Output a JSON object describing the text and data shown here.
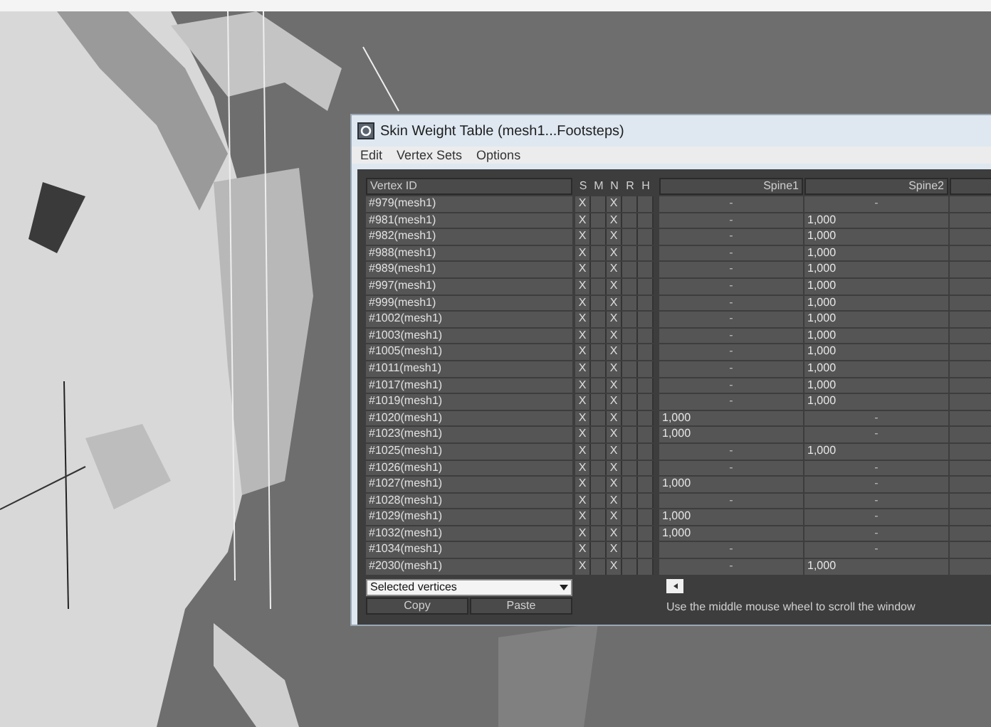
{
  "window": {
    "title": "Skin Weight Table (mesh1...Footsteps)"
  },
  "menu": [
    "Edit",
    "Vertex Sets",
    "Options"
  ],
  "columns": {
    "vertex": "Vertex ID",
    "flags": [
      "S",
      "M",
      "N",
      "R",
      "H"
    ],
    "bones": [
      "Spine1",
      "Spine2"
    ]
  },
  "rows": [
    {
      "id": "#979(mesh1)",
      "s": "X",
      "n": "X",
      "weights": [
        {
          "kind": "empty",
          "text": "-"
        },
        {
          "kind": "empty",
          "text": "-"
        }
      ]
    },
    {
      "id": "#981(mesh1)",
      "s": "X",
      "n": "X",
      "weights": [
        {
          "kind": "empty",
          "text": "-"
        },
        {
          "kind": "weight",
          "text": "1,000"
        }
      ]
    },
    {
      "id": "#982(mesh1)",
      "s": "X",
      "n": "X",
      "weights": [
        {
          "kind": "empty",
          "text": "-"
        },
        {
          "kind": "weight",
          "text": "1,000"
        }
      ]
    },
    {
      "id": "#988(mesh1)",
      "s": "X",
      "n": "X",
      "weights": [
        {
          "kind": "empty",
          "text": "-"
        },
        {
          "kind": "weight",
          "text": "1,000"
        }
      ]
    },
    {
      "id": "#989(mesh1)",
      "s": "X",
      "n": "X",
      "weights": [
        {
          "kind": "empty",
          "text": "-"
        },
        {
          "kind": "weight",
          "text": "1,000"
        }
      ]
    },
    {
      "id": "#997(mesh1)",
      "s": "X",
      "n": "X",
      "weights": [
        {
          "kind": "empty",
          "text": "-"
        },
        {
          "kind": "weight",
          "text": "1,000"
        }
      ]
    },
    {
      "id": "#999(mesh1)",
      "s": "X",
      "n": "X",
      "weights": [
        {
          "kind": "empty",
          "text": "-"
        },
        {
          "kind": "weight",
          "text": "1,000"
        }
      ]
    },
    {
      "id": "#1002(mesh1)",
      "s": "X",
      "n": "X",
      "weights": [
        {
          "kind": "empty",
          "text": "-"
        },
        {
          "kind": "weight",
          "text": "1,000"
        }
      ]
    },
    {
      "id": "#1003(mesh1)",
      "s": "X",
      "n": "X",
      "weights": [
        {
          "kind": "empty",
          "text": "-"
        },
        {
          "kind": "weight",
          "text": "1,000"
        }
      ]
    },
    {
      "id": "#1005(mesh1)",
      "s": "X",
      "n": "X",
      "weights": [
        {
          "kind": "empty",
          "text": "-"
        },
        {
          "kind": "weight",
          "text": "1,000"
        }
      ]
    },
    {
      "id": "#1011(mesh1)",
      "s": "X",
      "n": "X",
      "weights": [
        {
          "kind": "empty",
          "text": "-"
        },
        {
          "kind": "weight",
          "text": "1,000"
        }
      ]
    },
    {
      "id": "#1017(mesh1)",
      "s": "X",
      "n": "X",
      "weights": [
        {
          "kind": "empty",
          "text": "-"
        },
        {
          "kind": "weight",
          "text": "1,000"
        }
      ]
    },
    {
      "id": "#1019(mesh1)",
      "s": "X",
      "n": "X",
      "weights": [
        {
          "kind": "empty",
          "text": "-"
        },
        {
          "kind": "weight",
          "text": "1,000"
        }
      ]
    },
    {
      "id": "#1020(mesh1)",
      "s": "X",
      "n": "X",
      "weights": [
        {
          "kind": "weight",
          "text": "1,000"
        },
        {
          "kind": "empty",
          "text": "-"
        }
      ]
    },
    {
      "id": "#1023(mesh1)",
      "s": "X",
      "n": "X",
      "weights": [
        {
          "kind": "weight",
          "text": "1,000"
        },
        {
          "kind": "empty",
          "text": "-"
        }
      ]
    },
    {
      "id": "#1025(mesh1)",
      "s": "X",
      "n": "X",
      "weights": [
        {
          "kind": "empty",
          "text": "-"
        },
        {
          "kind": "weight",
          "text": "1,000"
        }
      ]
    },
    {
      "id": "#1026(mesh1)",
      "s": "X",
      "n": "X",
      "weights": [
        {
          "kind": "empty",
          "text": "-"
        },
        {
          "kind": "empty",
          "text": "-"
        }
      ]
    },
    {
      "id": "#1027(mesh1)",
      "s": "X",
      "n": "X",
      "weights": [
        {
          "kind": "weight",
          "text": "1,000"
        },
        {
          "kind": "empty",
          "text": "-"
        }
      ]
    },
    {
      "id": "#1028(mesh1)",
      "s": "X",
      "n": "X",
      "weights": [
        {
          "kind": "empty",
          "text": "-"
        },
        {
          "kind": "empty",
          "text": "-"
        }
      ]
    },
    {
      "id": "#1029(mesh1)",
      "s": "X",
      "n": "X",
      "weights": [
        {
          "kind": "weight",
          "text": "1,000"
        },
        {
          "kind": "empty",
          "text": "-"
        }
      ]
    },
    {
      "id": "#1032(mesh1)",
      "s": "X",
      "n": "X",
      "weights": [
        {
          "kind": "weight",
          "text": "1,000"
        },
        {
          "kind": "empty",
          "text": "-"
        }
      ]
    },
    {
      "id": "#1034(mesh1)",
      "s": "X",
      "n": "X",
      "weights": [
        {
          "kind": "empty",
          "text": "-"
        },
        {
          "kind": "empty",
          "text": "-"
        }
      ]
    },
    {
      "id": "#2030(mesh1)",
      "s": "X",
      "n": "X",
      "weights": [
        {
          "kind": "empty",
          "text": "-"
        },
        {
          "kind": "weight",
          "text": "1,000"
        }
      ]
    }
  ],
  "vertex_filter": {
    "value": "Selected vertices"
  },
  "buttons": [
    "Copy",
    "Paste"
  ],
  "hint": "Use the middle mouse wheel to scroll the window"
}
